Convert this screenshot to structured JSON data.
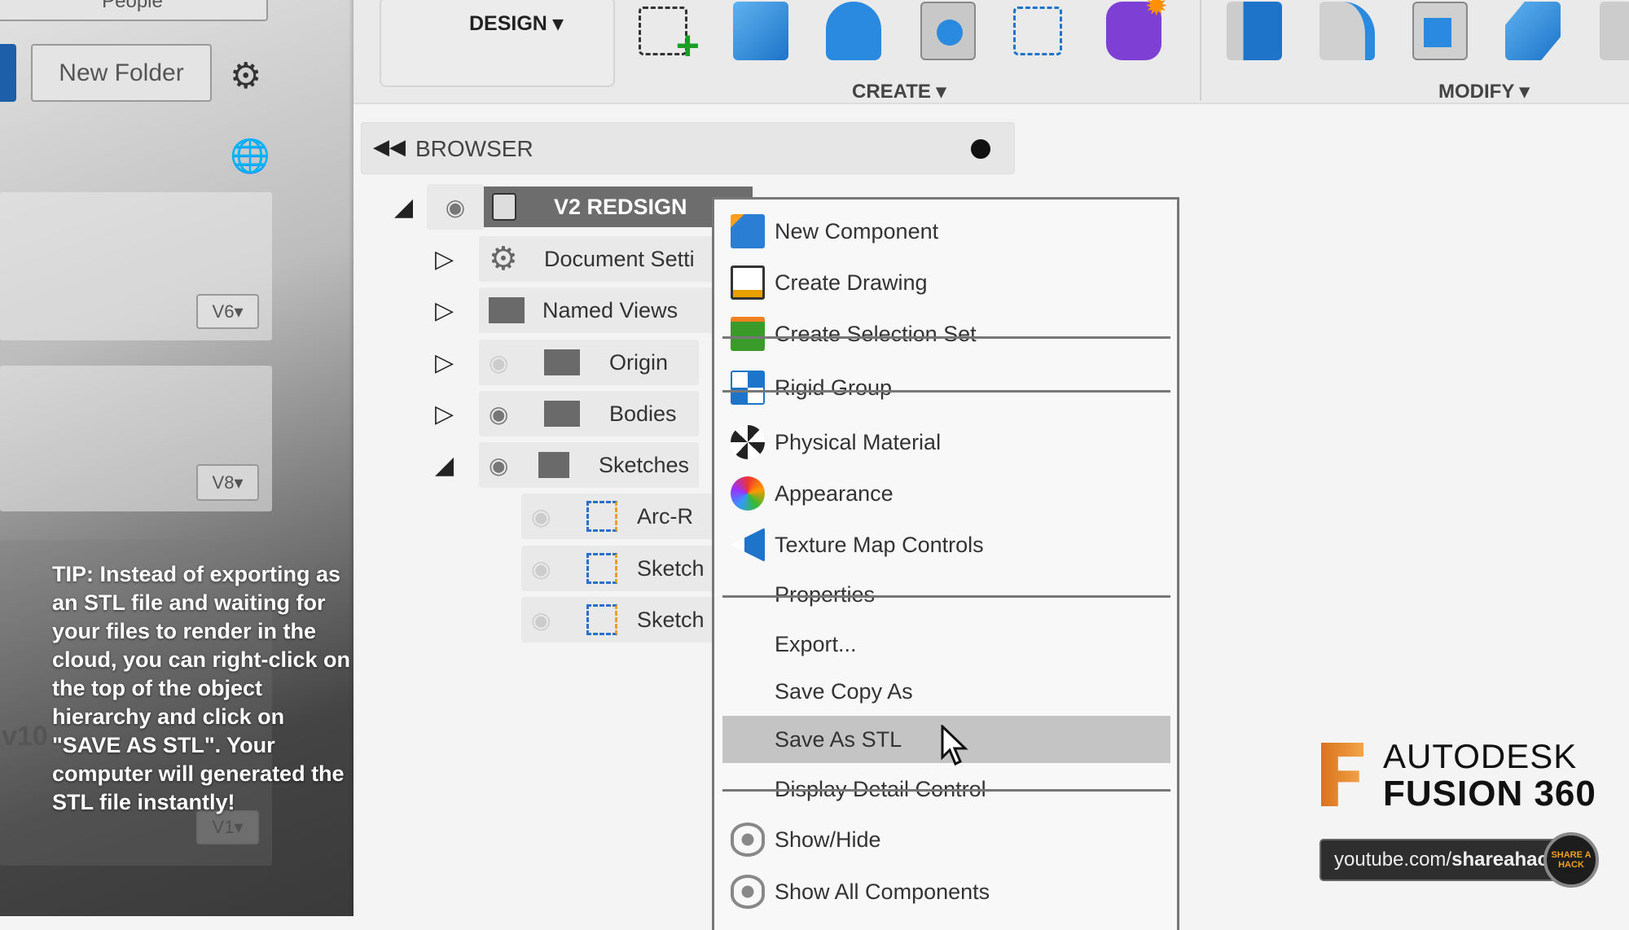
{
  "left_panel": {
    "people_button": "People",
    "new_folder_button": "New Folder",
    "versions": [
      "V6",
      "V8",
      "V1"
    ],
    "partial_label": "v10"
  },
  "tip": "TIP: Instead of exporting as an STL file and waiting for your files to render in the cloud, you can right-click on the top of the object hierarchy and click on \"SAVE AS STL\". Your computer will generated the STL file instantly!",
  "toolbar": {
    "workspace": "DESIGN",
    "groups": [
      {
        "label": "CREATE"
      },
      {
        "label": "MODIFY"
      }
    ]
  },
  "browser": {
    "title": "BROWSER",
    "root": "V2 REDSIGN",
    "items": [
      {
        "label": "Document Setti",
        "icon": "gear-icon"
      },
      {
        "label": "Named Views",
        "icon": "folder-icon"
      },
      {
        "label": "Origin",
        "icon": "folder-icon"
      },
      {
        "label": "Bodies",
        "icon": "folder-icon"
      },
      {
        "label": "Sketches",
        "icon": "folder-icon"
      },
      {
        "label": "Arc-R",
        "icon": "sketch-icon"
      },
      {
        "label": "Sketch",
        "icon": "sketch-icon"
      },
      {
        "label": "Sketch",
        "icon": "sketch-icon"
      }
    ]
  },
  "context_menu": {
    "items": [
      {
        "label": "New Component",
        "icon": "new-component-icon"
      },
      {
        "label": "Create Drawing",
        "icon": "drawing-icon"
      },
      {
        "label": "Create Selection Set",
        "icon": "selection-set-icon"
      },
      {
        "label": "Rigid Group",
        "icon": "rigid-group-icon"
      },
      {
        "label": "Physical Material",
        "icon": "material-icon"
      },
      {
        "label": "Appearance",
        "icon": "appearance-icon"
      },
      {
        "label": "Texture Map Controls",
        "icon": "texture-map-icon"
      },
      {
        "label": "Properties"
      },
      {
        "label": "Export..."
      },
      {
        "label": "Save Copy As"
      },
      {
        "label": "Save As STL",
        "highlighted": true
      },
      {
        "label": "Display Detail Control"
      },
      {
        "label": "Show/Hide",
        "icon": "eye-icon"
      },
      {
        "label": "Show All Components",
        "icon": "eye-icon"
      }
    ]
  },
  "branding": {
    "brand": "AUTODESK",
    "product": "FUSION 360",
    "url_prefix": "youtube.com/",
    "url_bold": "shareahack",
    "badge": "SHARE A HACK",
    "logo_color": "#e8892a"
  }
}
